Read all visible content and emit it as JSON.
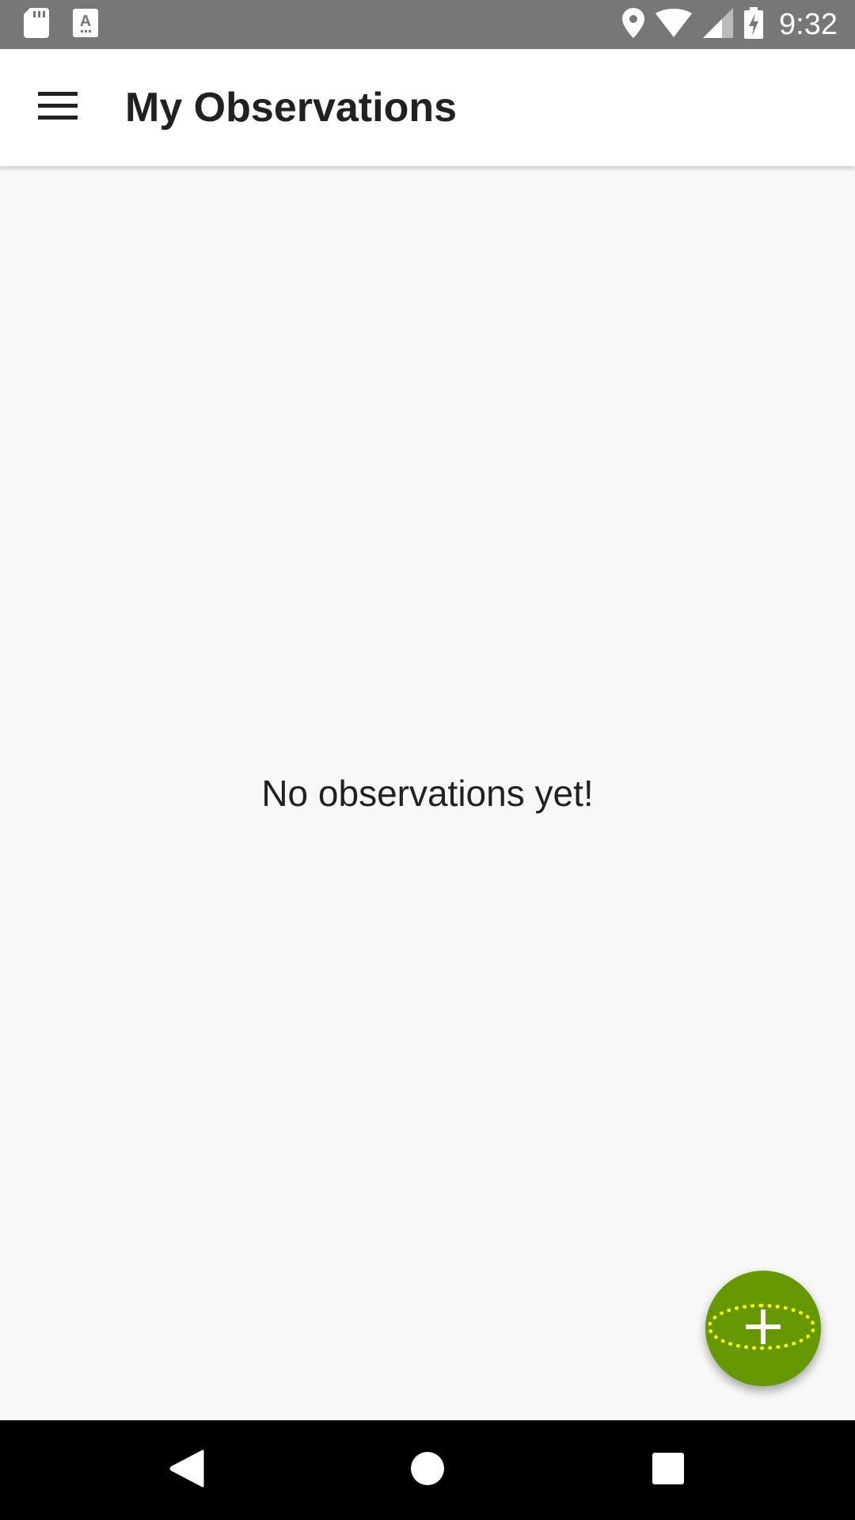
{
  "status_bar": {
    "time": "9:32",
    "left_icons": [
      "sd-card-icon",
      "text-a-icon"
    ],
    "right_icons": [
      "location-pin-icon",
      "wifi-icon",
      "signal-icon",
      "battery-charging-icon"
    ]
  },
  "app_bar": {
    "title": "My Observations",
    "menu_icon": "hamburger-menu-icon"
  },
  "content": {
    "empty_message": "No observations yet!"
  },
  "fab": {
    "icon": "plus-icon",
    "color": "#669900",
    "focus_ring_color": "#ffff00"
  },
  "nav_bar": {
    "buttons": [
      "back",
      "home",
      "recents"
    ]
  },
  "colors": {
    "status_bar": "#777777",
    "app_bar": "#ffffff",
    "background": "#f8f8f8",
    "nav_bar": "#000000",
    "title_text": "#212121"
  }
}
